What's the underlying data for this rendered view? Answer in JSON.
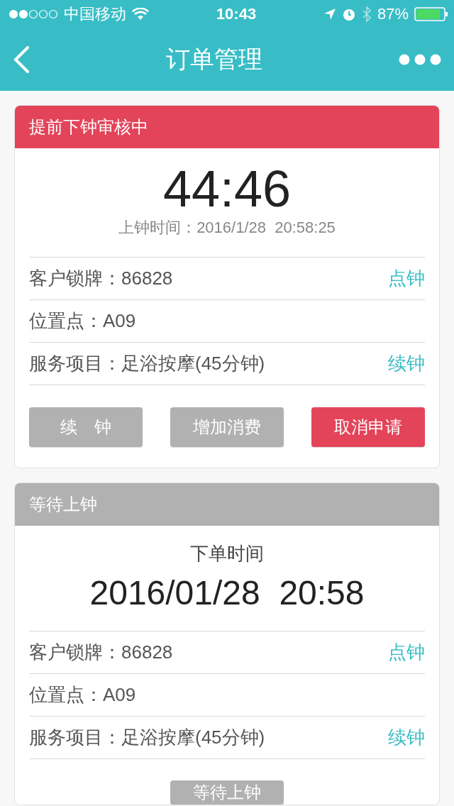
{
  "status_bar": {
    "carrier": "中国移动",
    "time": "10:43",
    "battery": "87%"
  },
  "nav": {
    "title": "订单管理"
  },
  "orders": [
    {
      "kind": "review",
      "header": "提前下钟审核中",
      "timer": "44:46",
      "start_time": "上钟时间：2016/1/28  20:58:25",
      "rows": [
        {
          "label": "客户锁牌：86828",
          "action": "点钟"
        },
        {
          "label": "位置点：A09"
        },
        {
          "label": "服务项目：足浴按摩(45分钟)",
          "action": "续钟"
        }
      ],
      "buttons": [
        {
          "label": "续　钟",
          "kind": "gray"
        },
        {
          "label": "增加消费",
          "kind": "gray"
        },
        {
          "label": "取消申请",
          "kind": "red"
        }
      ]
    },
    {
      "kind": "waiting",
      "header": "等待上钟",
      "order_label": "下单时间",
      "order_time": "2016/01/28  20:58",
      "rows": [
        {
          "label": "客户锁牌：86828",
          "action": "点钟"
        },
        {
          "label": "位置点：A09"
        },
        {
          "label": "服务项目：足浴按摩(45分钟)",
          "action": "续钟"
        }
      ],
      "buttons": [
        {
          "label": "等待上钟",
          "kind": "gray"
        }
      ]
    }
  ]
}
